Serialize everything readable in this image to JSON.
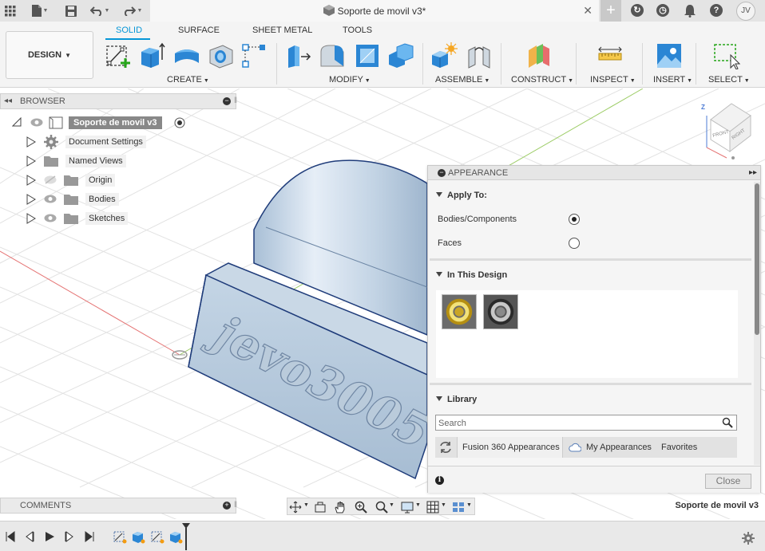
{
  "document": {
    "title": "Soporte de movil v3*",
    "status_name": "Soporte de movil v3"
  },
  "user": {
    "initials": "JV"
  },
  "ribbon": {
    "workspace": "DESIGN",
    "tabs": [
      {
        "label": "SOLID",
        "active": true
      },
      {
        "label": "SURFACE",
        "active": false
      },
      {
        "label": "SHEET METAL",
        "active": false
      },
      {
        "label": "TOOLS",
        "active": false
      }
    ],
    "groups": [
      "CREATE",
      "MODIFY",
      "ASSEMBLE",
      "CONSTRUCT",
      "INSPECT",
      "INSERT",
      "SELECT"
    ]
  },
  "browser": {
    "title": "BROWSER",
    "root": "Soporte de movil v3",
    "items": [
      {
        "label": "Document Settings",
        "icon": "gear-icon"
      },
      {
        "label": "Named Views",
        "icon": "folder-icon"
      },
      {
        "label": "Origin",
        "icon": "folder-icon",
        "hidden": true
      },
      {
        "label": "Bodies",
        "icon": "folder-icon"
      },
      {
        "label": "Sketches",
        "icon": "folder-icon"
      }
    ]
  },
  "model": {
    "engraved_text": "jevo3005"
  },
  "viewcube": {
    "front": "FRONT",
    "right": "RIGHT"
  },
  "appearance": {
    "title": "APPEARANCE",
    "apply_to": {
      "title": "Apply To:",
      "options": [
        {
          "label": "Bodies/Components",
          "selected": true
        },
        {
          "label": "Faces",
          "selected": false
        }
      ]
    },
    "in_this_design": {
      "title": "In This Design"
    },
    "library": {
      "title": "Library",
      "search_placeholder": "Search",
      "tabs": [
        "Fusion 360 Appearances",
        "My Appearances",
        "Favorites"
      ]
    },
    "close_label": "Close"
  },
  "comments": {
    "title": "COMMENTS"
  },
  "colors": {
    "accent": "#0696d7",
    "body": "#b9cbdc",
    "edge": "#1f3c7a"
  }
}
